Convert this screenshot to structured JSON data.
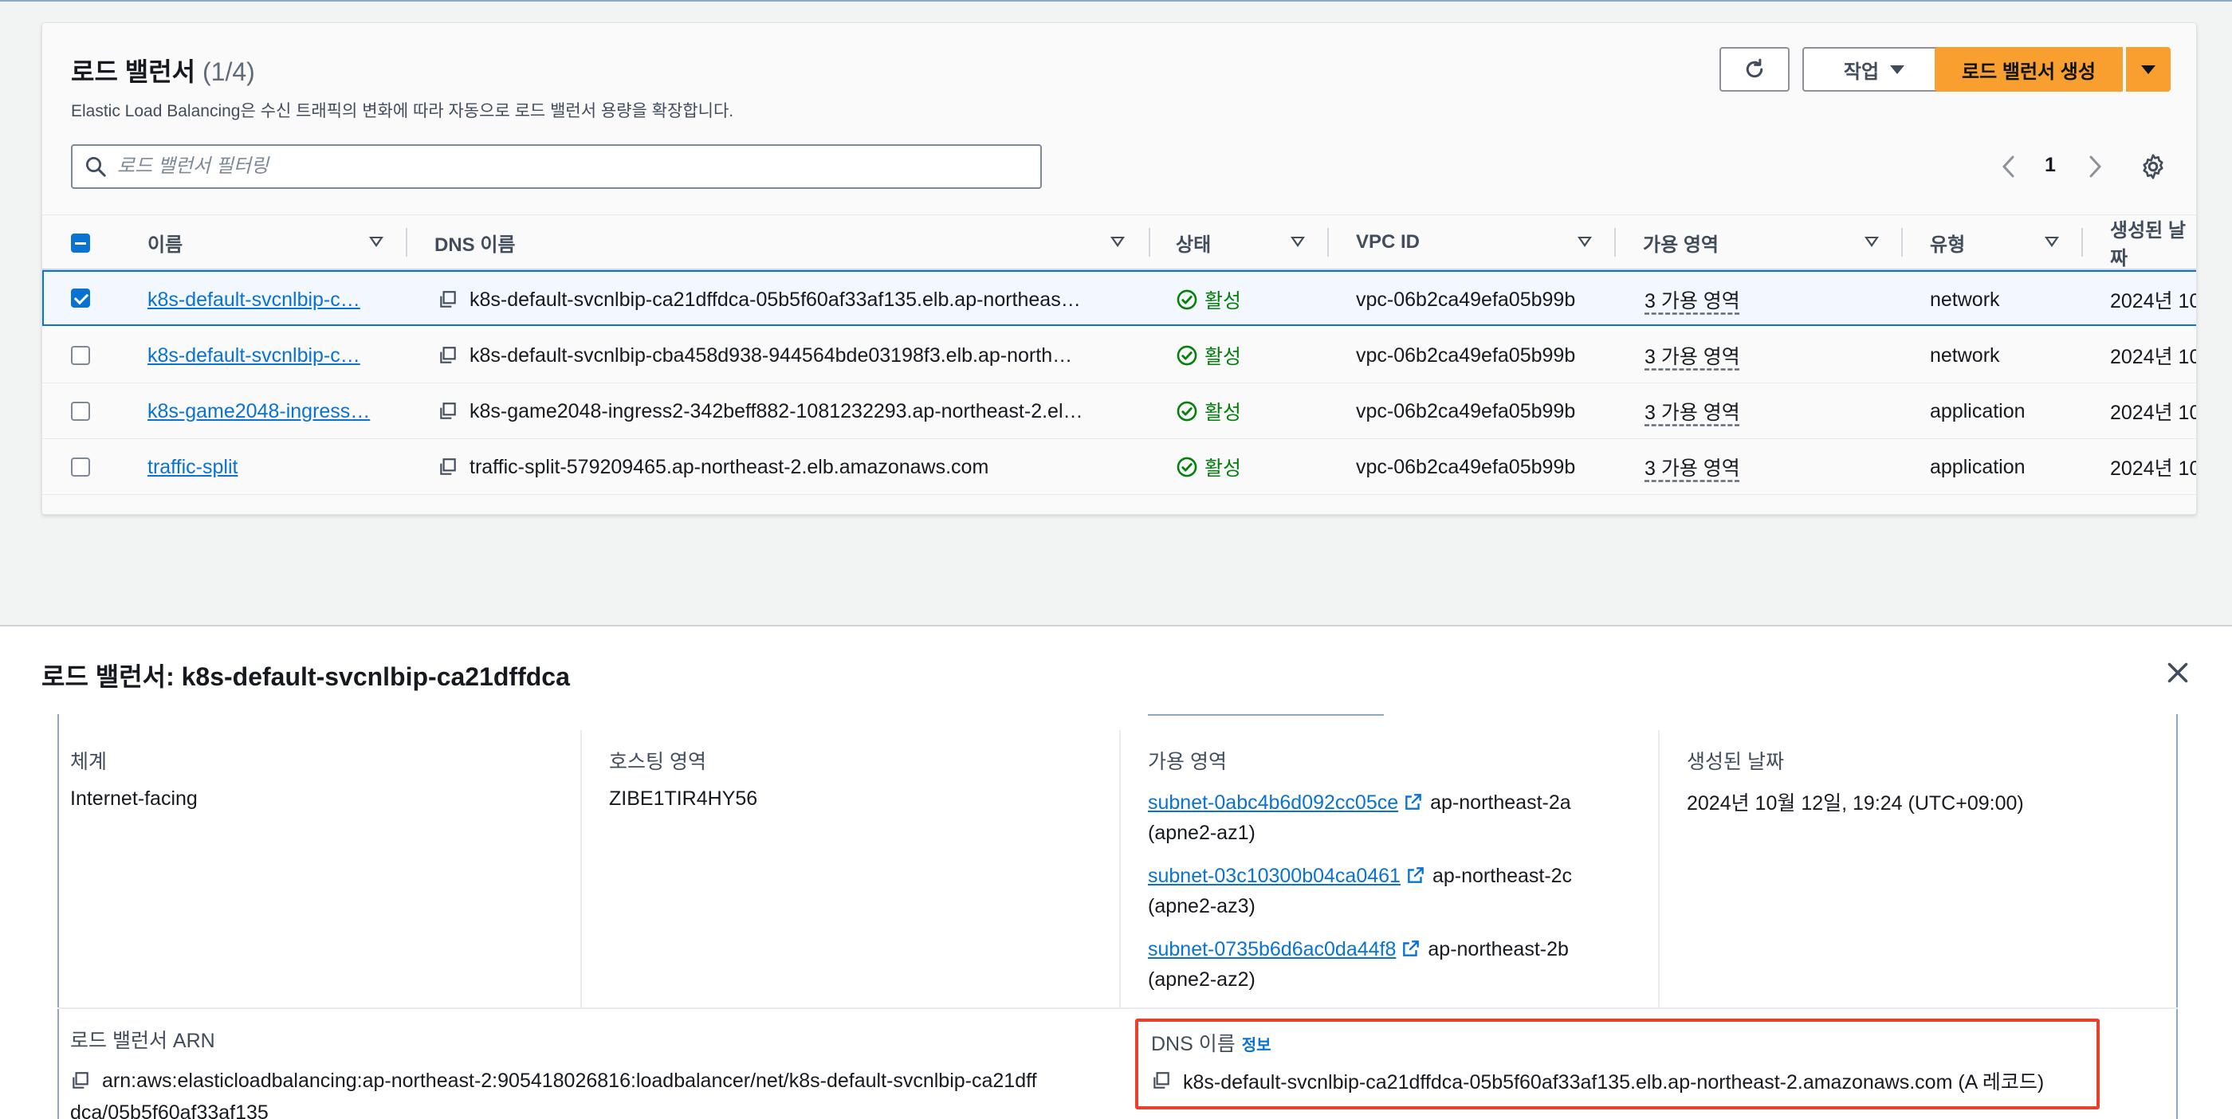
{
  "list": {
    "title": "로드 밸런서",
    "count": "(1/4)",
    "description": "Elastic Load Balancing은 수신 트래픽의 변화에 따라 자동으로 로드 밸런서 용량을 확장합니다.",
    "actions_label": "작업",
    "create_label": "로드 밸런서 생성",
    "filter_placeholder": "로드 밸런서 필터링",
    "page": "1",
    "columns": [
      "이름",
      "DNS 이름",
      "상태",
      "VPC ID",
      "가용 영역",
      "유형",
      "생성된 날짜"
    ],
    "rows": [
      {
        "name": "k8s-default-svcnlbip-c…",
        "dns": "k8s-default-svcnlbip-ca21dffdca-05b5f60af33af135.elb.ap-northeas…",
        "status": "활성",
        "vpc": "vpc-06b2ca49efa05b99b",
        "az": "3 가용 영역",
        "type": "network",
        "created": "2024년 10"
      },
      {
        "name": "k8s-default-svcnlbip-c…",
        "dns": "k8s-default-svcnlbip-cba458d938-944564bde03198f3.elb.ap-north…",
        "status": "활성",
        "vpc": "vpc-06b2ca49efa05b99b",
        "az": "3 가용 영역",
        "type": "network",
        "created": "2024년 10"
      },
      {
        "name": "k8s-game2048-ingress…",
        "dns": "k8s-game2048-ingress2-342beff882-1081232293.ap-northeast-2.el…",
        "status": "활성",
        "vpc": "vpc-06b2ca49efa05b99b",
        "az": "3 가용 영역",
        "type": "application",
        "created": "2024년 10"
      },
      {
        "name": "traffic-split",
        "dns": "traffic-split-579209465.ap-northeast-2.elb.amazonaws.com",
        "status": "활성",
        "vpc": "vpc-06b2ca49efa05b99b",
        "az": "3 가용 영역",
        "type": "application",
        "created": "2024년 10"
      }
    ]
  },
  "detail": {
    "title": "로드 밸런서: k8s-default-svcnlbip-ca21dffdca",
    "scheme_label": "체계",
    "scheme_value": "Internet-facing",
    "hosted_zone_label": "호스팅 영역",
    "hosted_zone_value": "ZIBE1TIR4HY56",
    "az_label": "가용 영역",
    "subnets": [
      {
        "id": "subnet-0abc4b6d092cc05ce",
        "zone": "ap-northeast-2a",
        "zone_id": "(apne2-az1)"
      },
      {
        "id": "subnet-03c10300b04ca0461",
        "zone": "ap-northeast-2c",
        "zone_id": "(apne2-az3)"
      },
      {
        "id": "subnet-0735b6d6ac0da44f8",
        "zone": "ap-northeast-2b",
        "zone_id": "(apne2-az2)"
      }
    ],
    "created_label": "생성된 날짜",
    "created_value": "2024년 10월 12일, 19:24 (UTC+09:00)",
    "arn_label": "로드 밸런서 ARN",
    "arn_line1": "arn:aws:elasticloadbalancing:ap-northeast-2:905418026816:loadbalancer/net/k8s-default-svcnlbip-ca21dff",
    "arn_line2": "dca/05b5f60af33af135",
    "dns_label": "DNS 이름",
    "dns_info": "정보",
    "dns_value": "k8s-default-svcnlbip-ca21dffdca-05b5f60af33af135.elb.ap-northeast-2.amazonaws.com (A 레코드)"
  },
  "colors": {
    "accent": "#0972d3",
    "primary_button": "#f89f30",
    "success": "#037f0c",
    "highlight": "#e8402a"
  }
}
